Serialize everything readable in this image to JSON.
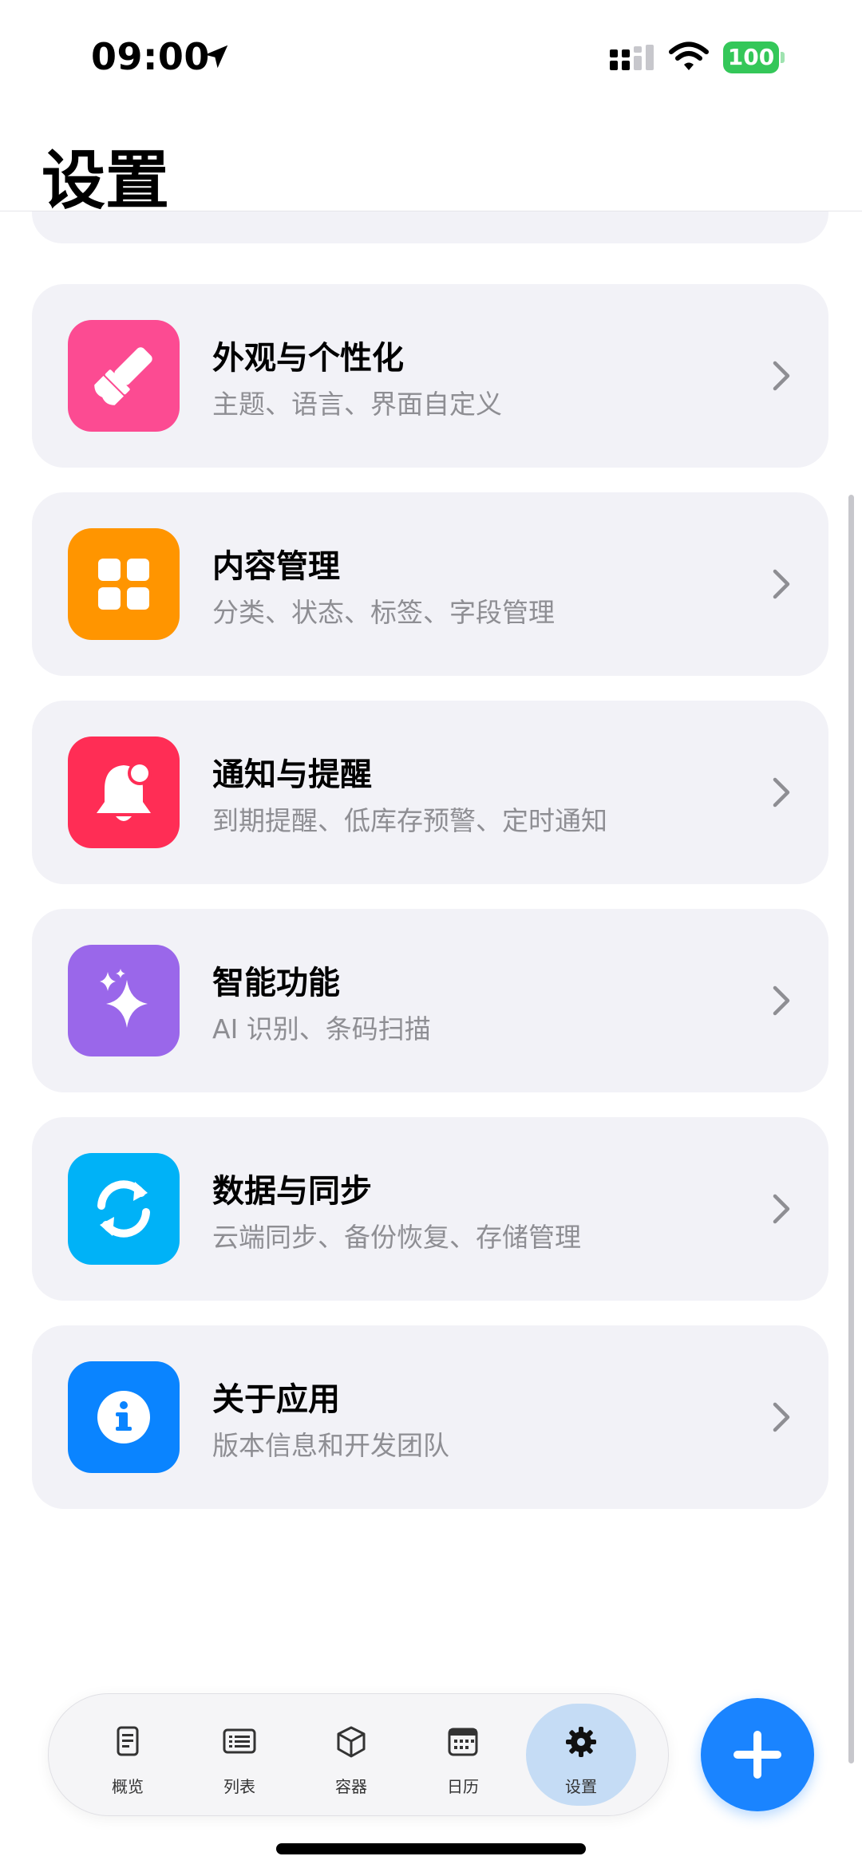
{
  "status_bar": {
    "time": "09:00",
    "battery": "100"
  },
  "header": {
    "title": "设置"
  },
  "settings": [
    {
      "title": "外观与个性化",
      "subtitle": "主题、语言、界面自定义",
      "icon": "paintbrush-icon",
      "color": "#fc4b92"
    },
    {
      "title": "内容管理",
      "subtitle": "分类、状态、标签、字段管理",
      "icon": "grid-icon",
      "color": "#ff9500"
    },
    {
      "title": "通知与提醒",
      "subtitle": "到期提醒、低库存预警、定时通知",
      "icon": "bell-badge-icon",
      "color": "#ff2d55"
    },
    {
      "title": "智能功能",
      "subtitle": "AI 识别、条码扫描",
      "icon": "sparkles-icon",
      "color": "#9a67ea"
    },
    {
      "title": "数据与同步",
      "subtitle": "云端同步、备份恢复、存储管理",
      "icon": "sync-icon",
      "color": "#00b2f7"
    },
    {
      "title": "关于应用",
      "subtitle": "版本信息和开发团队",
      "icon": "info-icon",
      "color": "#0a84ff"
    }
  ],
  "tabs": [
    {
      "label": "概览",
      "icon": "document-icon",
      "active": false
    },
    {
      "label": "列表",
      "icon": "list-icon",
      "active": false
    },
    {
      "label": "容器",
      "icon": "box-icon",
      "active": false
    },
    {
      "label": "日历",
      "icon": "calendar-icon",
      "active": false
    },
    {
      "label": "设置",
      "icon": "gear-icon",
      "active": true
    }
  ],
  "fab": {
    "icon": "plus-icon",
    "color": "#1a84ff"
  }
}
